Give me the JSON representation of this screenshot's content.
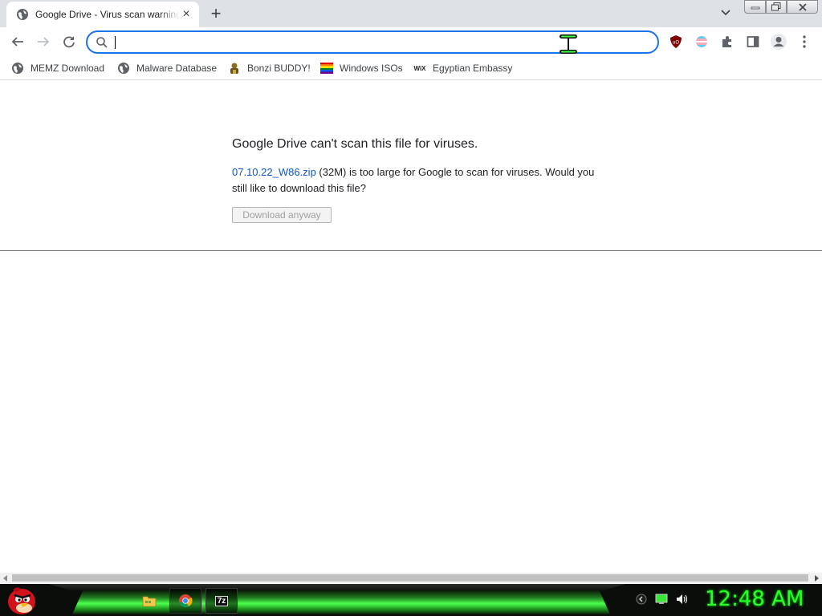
{
  "tab": {
    "title": "Google Drive - Virus scan warning",
    "close_glyph": "×",
    "new_tab_glyph": "+"
  },
  "omnibox": {
    "value": "",
    "placeholder": ""
  },
  "bookmarks": [
    {
      "label": "MEMZ Download",
      "icon": "globe-icon"
    },
    {
      "label": "Malware Database",
      "icon": "globe-icon"
    },
    {
      "label": "Bonzi BUDDY!",
      "icon": "bonzi-icon"
    },
    {
      "label": "Windows ISOs",
      "icon": "rainbow-flag-icon"
    },
    {
      "label": "Egyptian Embassy",
      "icon": "wix-icon"
    }
  ],
  "wix_text": "WiX",
  "page": {
    "title": "Google Drive can't scan this file for viruses.",
    "file_name": "07.10.22_W86.zip",
    "message_rest": " (32M) is too large for Google to scan for viruses. Would you still like to download this file?",
    "download_button": "Download anyway"
  },
  "taskbar": {
    "clock": "12:48 AM",
    "sevenzip_label": "7z"
  },
  "colors": {
    "accent": "#1a73e8",
    "link": "#1155cc",
    "clock": "#2bff2b",
    "taskbar_glow": "#4cff4c"
  }
}
